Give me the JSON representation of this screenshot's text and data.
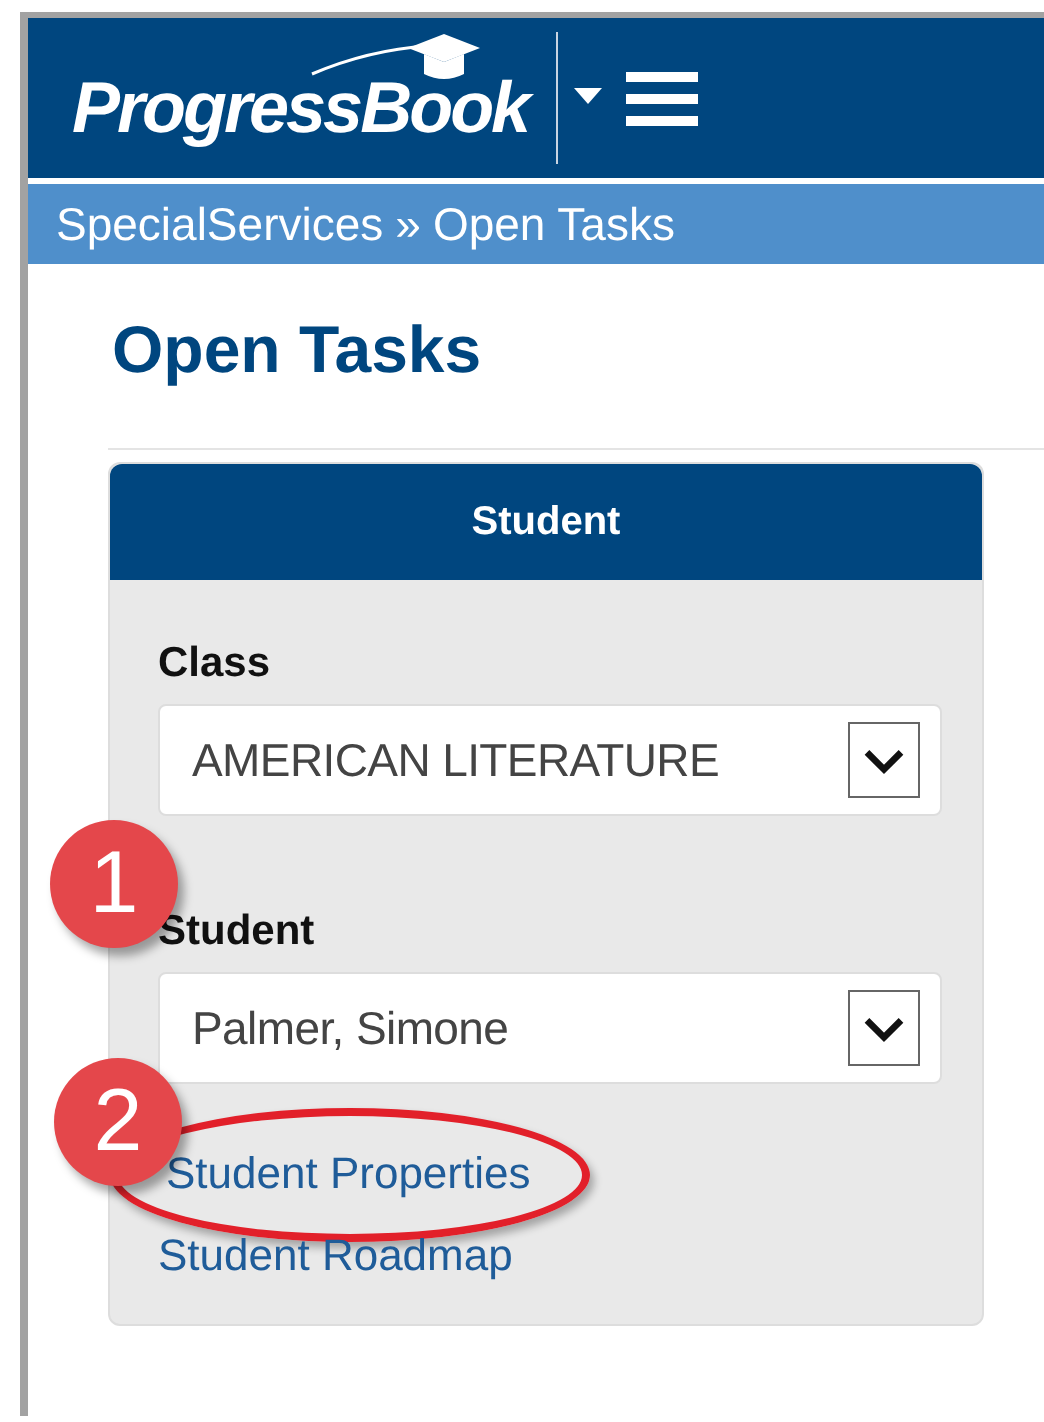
{
  "header": {
    "logo": "ProgressBook"
  },
  "breadcrumb": [
    "SpecialServices",
    "»",
    "Open Tasks"
  ],
  "page_title": "Open Tasks",
  "panel": {
    "title": "Student",
    "fields": [
      {
        "label": "Class",
        "value": "AMERICAN LITERATURE"
      },
      {
        "label": "Student",
        "value": "Palmer, Simone"
      }
    ],
    "links": [
      {
        "label": "Student Properties",
        "highlighted": true
      },
      {
        "label": "Student Roadmap",
        "highlighted": false
      }
    ]
  },
  "callouts": [
    {
      "label": "1"
    },
    {
      "label": "2"
    }
  ]
}
